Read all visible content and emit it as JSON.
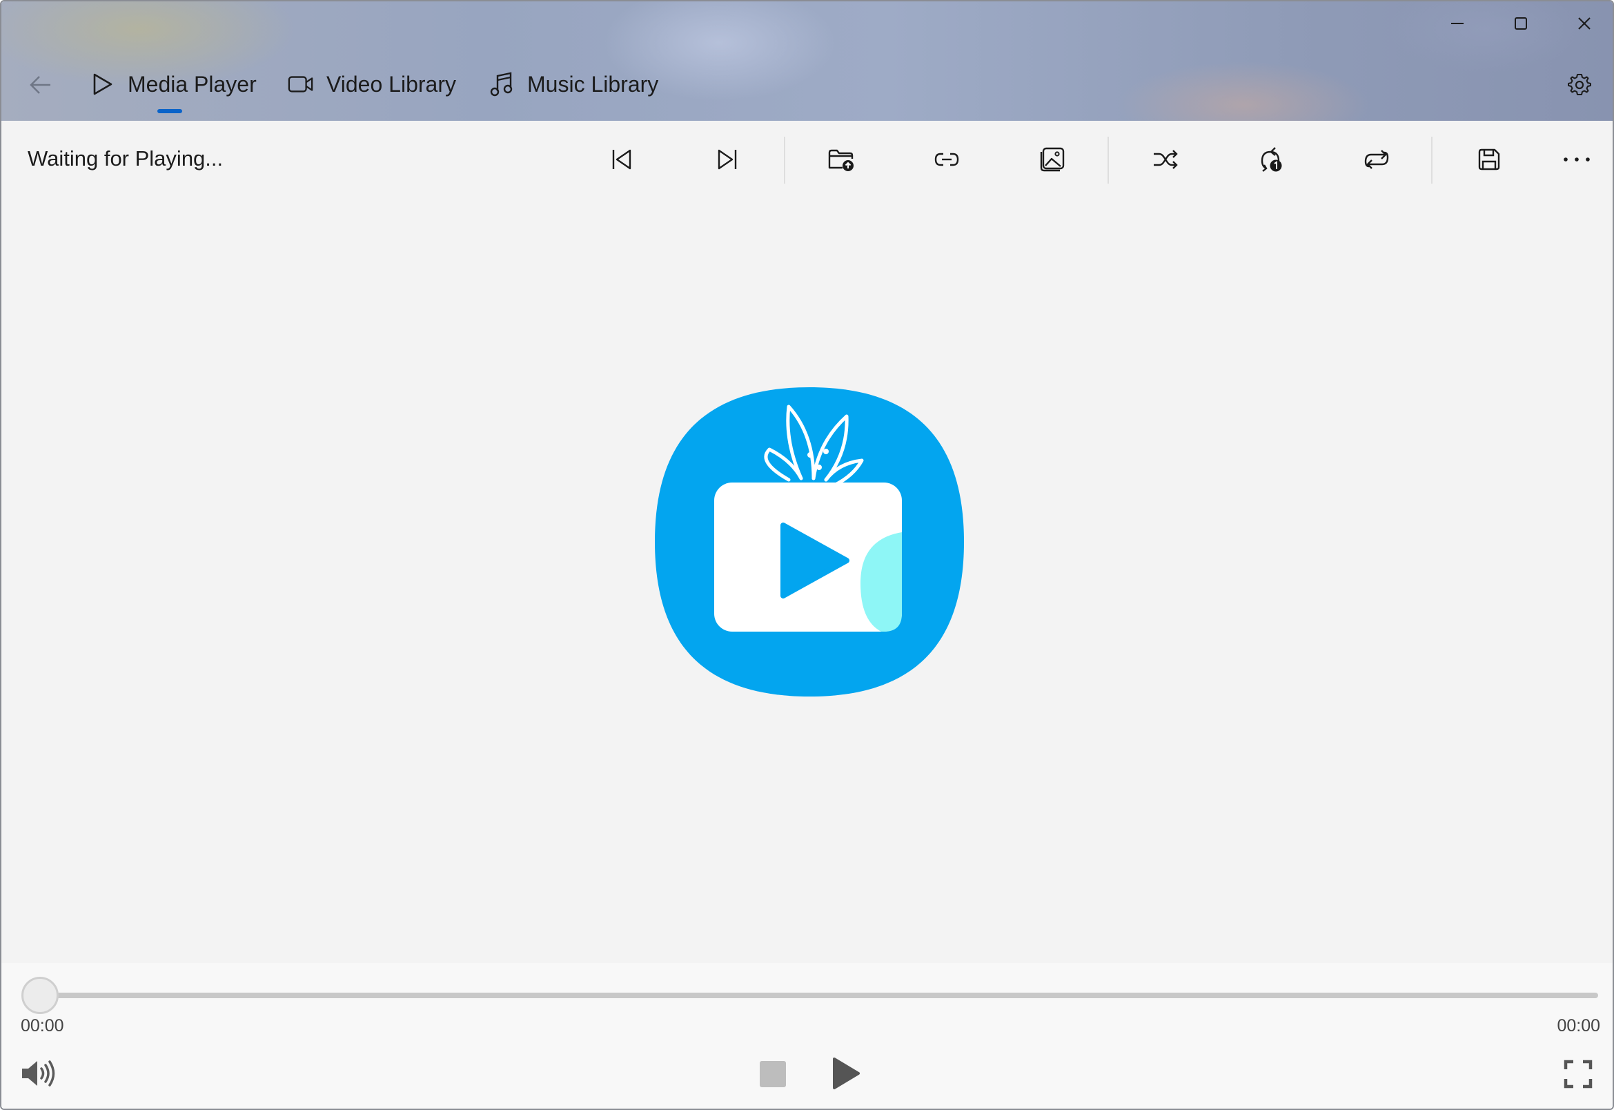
{
  "window": {
    "caption_buttons": [
      "minimize-icon",
      "maximize-icon",
      "close-icon"
    ]
  },
  "nav": {
    "back_icon": "back-arrow-icon",
    "tabs": [
      {
        "label": "Media Player",
        "icon": "play-outline-icon",
        "selected": true
      },
      {
        "label": "Video Library",
        "icon": "video-camera-icon",
        "selected": false
      },
      {
        "label": "Music Library",
        "icon": "music-note-icon",
        "selected": false
      }
    ],
    "settings_icon": "gear-icon",
    "accent_color": "#0a63c9"
  },
  "commandbar": {
    "status": "Waiting for Playing...",
    "commands": [
      "previous-track-icon",
      "next-track-icon",
      "open-folder-icon",
      "open-link-icon",
      "image-icon",
      "shuffle-icon",
      "repeat-one-icon",
      "repeat-all-icon",
      "save-icon",
      "more-options-icon"
    ]
  },
  "content": {
    "logo_icon": "app-logo-icon",
    "logo_color": "#03a5ef",
    "logo_accent": "#8ef6f6"
  },
  "transport": {
    "position": 0,
    "time_current": "00:00",
    "time_total": "00:00",
    "volume_icon": "volume-icon",
    "stop_icon": "stop-icon",
    "play_icon": "play-icon",
    "fullscreen_icon": "fullscreen-icon"
  }
}
